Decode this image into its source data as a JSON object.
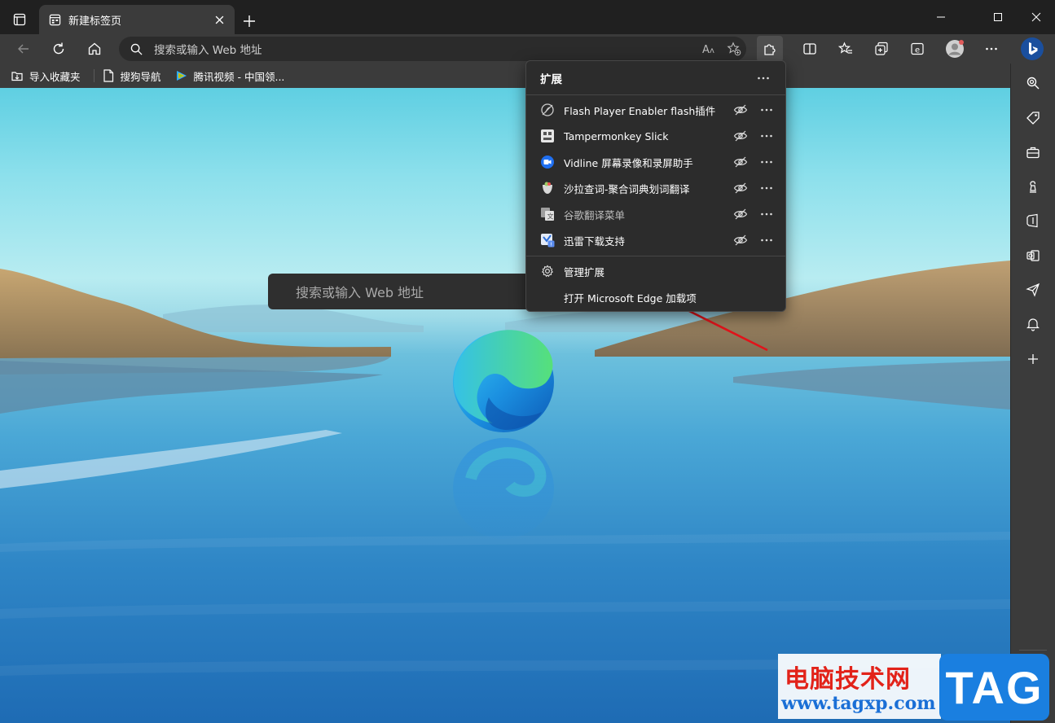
{
  "browser": {
    "tab": {
      "title": "新建标签页"
    },
    "omnibox": {
      "placeholder": "搜索或输入 Web 地址"
    }
  },
  "favorites_bar": {
    "items": [
      {
        "label": "导入收藏夹",
        "icon": "import-favorites-icon"
      },
      {
        "label": "搜狗导航",
        "icon": "page-icon"
      },
      {
        "label": "腾讯视频 - 中国领...",
        "icon": "tencent-video-icon"
      }
    ]
  },
  "new_tab_page": {
    "search_placeholder": "搜索或输入 Web 地址"
  },
  "extensions_popup": {
    "title": "扩展",
    "extensions": [
      {
        "name": "Flash Player Enabler flash插件",
        "icon": "flash-icon",
        "dim": false
      },
      {
        "name": "Tampermonkey Slick",
        "icon": "tampermonkey-icon",
        "dim": false
      },
      {
        "name": "Vidline 屏幕录像和录屏助手",
        "icon": "vidline-icon",
        "dim": false
      },
      {
        "name": "沙拉查词-聚合词典划词翻译",
        "icon": "saladict-icon",
        "dim": false
      },
      {
        "name": "谷歌翻译菜单",
        "icon": "translate-icon",
        "dim": true
      },
      {
        "name": "迅雷下载支持",
        "icon": "thunder-icon",
        "dim": false
      }
    ],
    "manage_label": "管理扩展",
    "open_addons_label": "打开 Microsoft Edge 加载项"
  },
  "watermark": {
    "cn": "电脑技术网",
    "url": "www.tagxp.com",
    "tag": "TAG"
  },
  "colors": {
    "frame": "#202020",
    "toolbar": "#3b3b3b",
    "popup": "#2c2c2c",
    "arrow": "#e0141b"
  }
}
